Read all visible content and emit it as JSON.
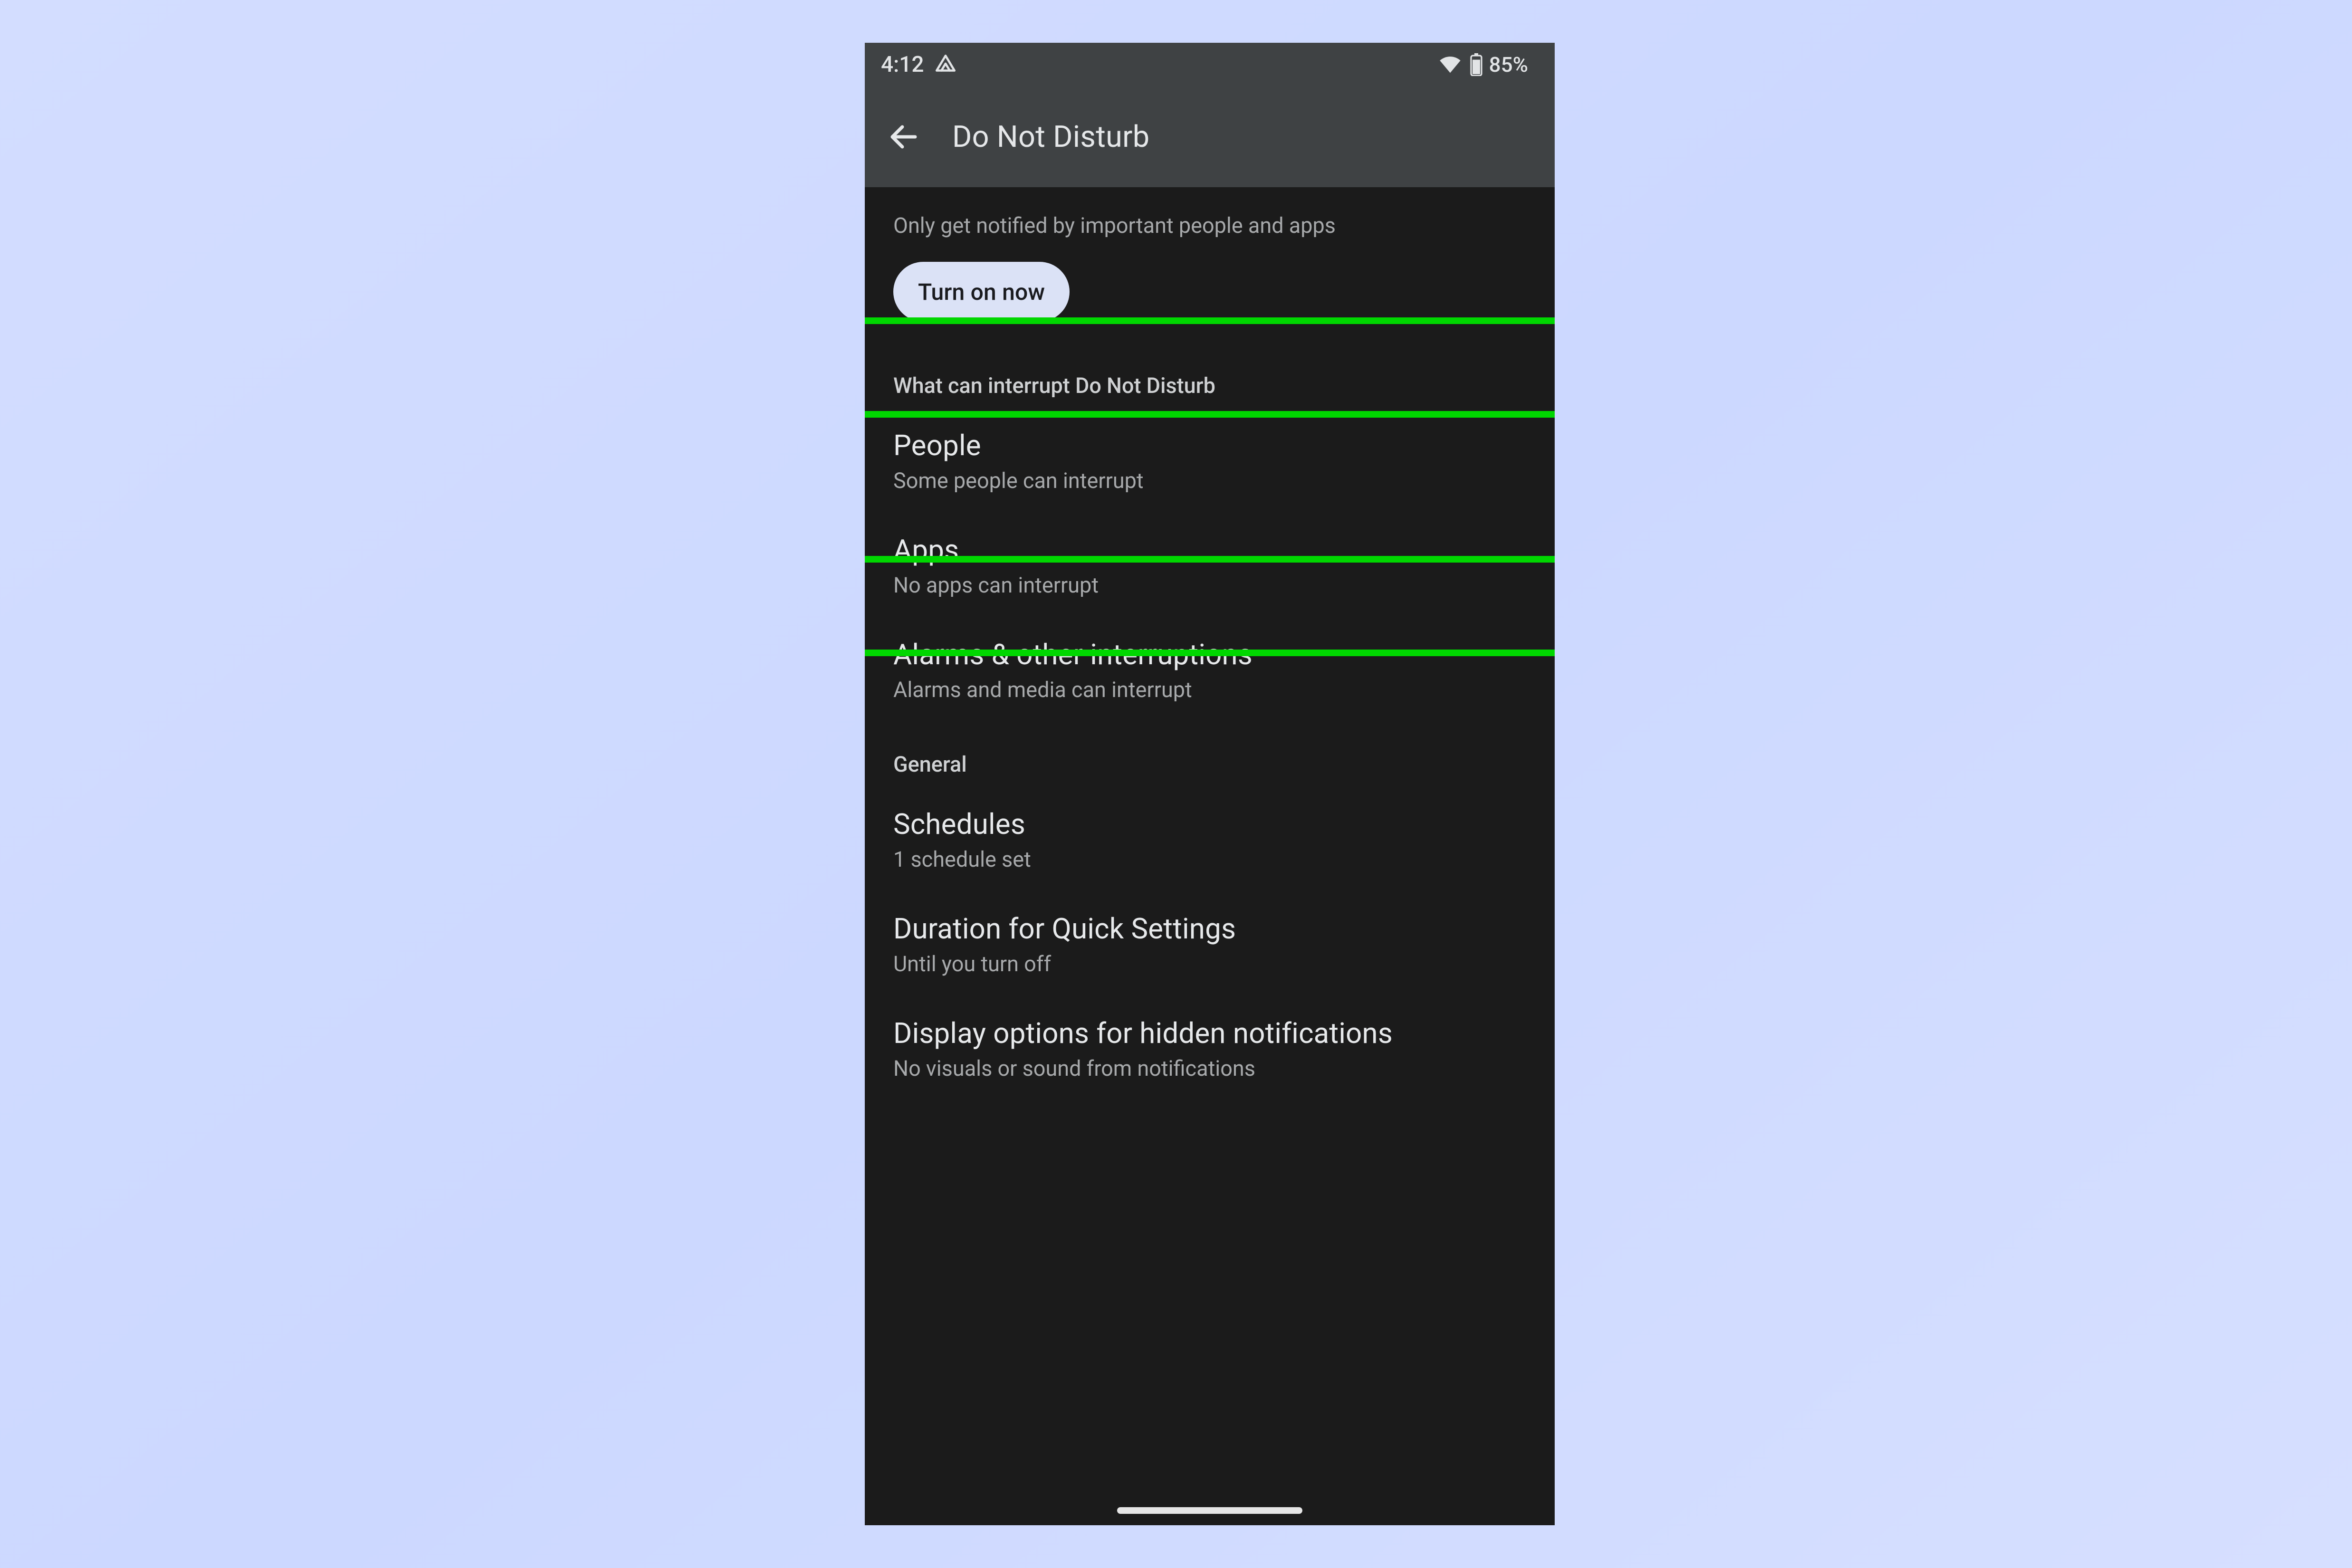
{
  "status": {
    "time": "4:12",
    "battery_text": "85%"
  },
  "header": {
    "title": "Do Not Disturb"
  },
  "subtitle": "Only get notified by important people and apps",
  "turn_on_label": "Turn on now",
  "sections": {
    "interrupt_header": "What can interrupt Do Not Disturb",
    "general_header": "General"
  },
  "items": {
    "people": {
      "title": "People",
      "subtitle": "Some people can interrupt"
    },
    "apps": {
      "title": "Apps",
      "subtitle": "No apps can interrupt"
    },
    "alarms": {
      "title": "Alarms & other interruptions",
      "subtitle": "Alarms and media can interrupt"
    },
    "schedules": {
      "title": "Schedules",
      "subtitle": "1 schedule set"
    },
    "duration": {
      "title": "Duration for Quick Settings",
      "subtitle": "Until you turn off"
    },
    "display_opts": {
      "title": "Display options for hidden notifications",
      "subtitle": "No visuals or sound from notifications"
    }
  }
}
